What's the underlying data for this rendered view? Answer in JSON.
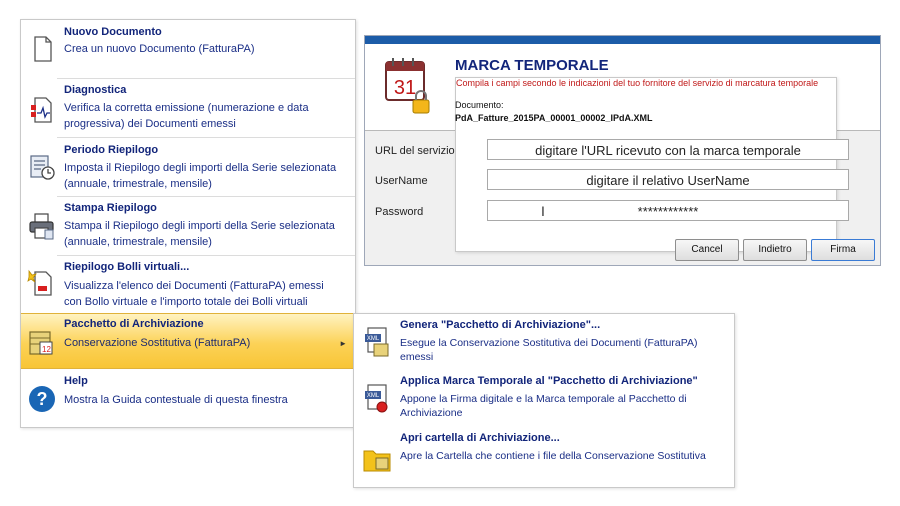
{
  "menu": {
    "items": [
      {
        "title": "Nuovo Documento",
        "desc": "Crea un nuovo Documento (FatturaPA)",
        "icon": "new-document-icon"
      },
      {
        "title": "Diagnostica",
        "desc": "Verifica la corretta emissione (numerazione e data progressiva) dei Documenti emessi",
        "icon": "diagnostics-icon"
      },
      {
        "title": "Periodo Riepilogo",
        "desc": "Imposta il Riepilogo degli importi della Serie selezionata (annuale, trimestrale, mensile)",
        "icon": "period-summary-icon"
      },
      {
        "title": "Stampa Riepilogo",
        "desc": "Stampa il Riepilogo degli importi della Serie selezionata (annuale, trimestrale, mensile)",
        "icon": "printer-icon"
      },
      {
        "title": "Riepilogo Bolli virtuali...",
        "desc": "Visualizza l'elenco dei Documenti (FatturaPA) emessi con Bollo virtuale e l'importo totale dei Bolli virtuali",
        "icon": "virtual-stamp-icon"
      },
      {
        "title": "Pacchetto di Archiviazione",
        "desc": "Conservazione Sostitutiva (FatturaPA)",
        "icon": "archive-package-icon"
      },
      {
        "title": "Help",
        "desc": "Mostra la Guida contestuale di questa finestra",
        "icon": "help-icon"
      }
    ]
  },
  "dialog": {
    "title": "MARCA TEMPORALE",
    "subtitle": "Compila i campi secondo le indicazioni del tuo fornitore del servizio di marcatura temporale",
    "calendar_day": "31",
    "doc_label": "Documento:",
    "doc_value": "PdA_Fatture_2015PA_00001_00002_IPdA.XML",
    "fields": [
      {
        "label": "URL del servizio",
        "value": "digitare l'URL ricevuto con la marca temporale"
      },
      {
        "label": "UserName",
        "value": "digitare il relativo UserName"
      },
      {
        "label": "Password",
        "value": "************"
      }
    ],
    "buttons": {
      "cancel": "Cancel",
      "back": "Indietro",
      "sign": "Firma"
    }
  },
  "submenu": {
    "items": [
      {
        "title": "Genera \"Pacchetto di Archiviazione\"...",
        "desc": "Esegue la Conservazione Sostitutiva dei Documenti (FatturaPA) emessi",
        "icon": "xml-archive-icon"
      },
      {
        "title": "Applica Marca Temporale al \"Pacchetto di Archiviazione\"",
        "desc": "Appone la Firma digitale e la Marca temporale al Pacchetto di Archiviazione",
        "icon": "xml-signature-icon"
      },
      {
        "title": "Apri cartella di Archiviazione...",
        "desc": "Apre la Cartella che contiene i file della Conservazione Sostitutiva",
        "icon": "folder-icon"
      }
    ]
  },
  "colors": {
    "title_blue": "#12257a",
    "highlight": "#fcd257",
    "dialog_bar": "#1c5ca8",
    "subtitle_red": "#c01818"
  }
}
